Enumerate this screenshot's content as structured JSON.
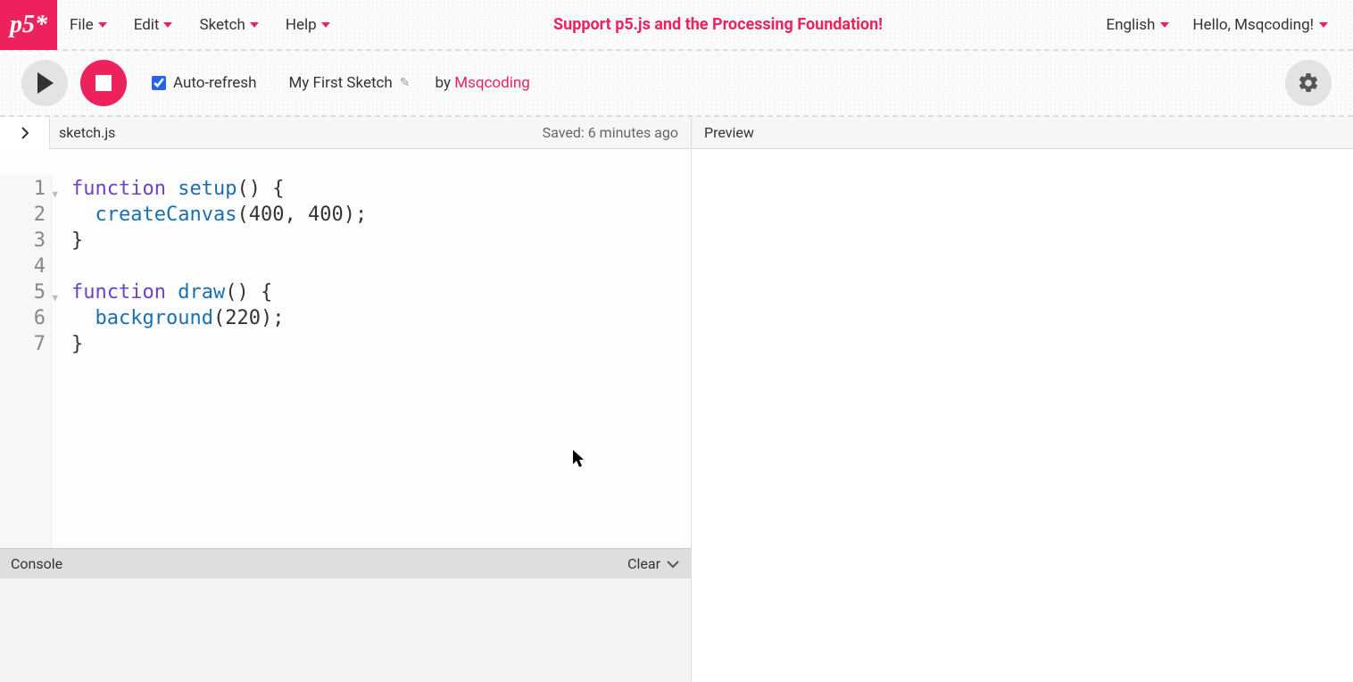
{
  "logo_text": "p5*",
  "menus": {
    "file": "File",
    "edit": "Edit",
    "sketch": "Sketch",
    "help": "Help"
  },
  "support_text": "Support p5.js and the Processing Foundation!",
  "language": "English",
  "greeting": "Hello, Msqcoding!",
  "toolbar": {
    "autorefresh_label": "Auto-refresh",
    "autorefresh_checked": true,
    "sketch_name": "My First Sketch",
    "by_label": "by",
    "author": "Msqcoding"
  },
  "filebar": {
    "filename": "sketch.js",
    "saved_text": "Saved: 6 minutes ago"
  },
  "preview_label": "Preview",
  "code": {
    "lines": [
      {
        "n": 1,
        "fold": true,
        "tokens": [
          [
            "kw",
            "function"
          ],
          [
            "txt",
            " "
          ],
          [
            "fn",
            "setup"
          ],
          [
            "txt",
            "() {"
          ]
        ]
      },
      {
        "n": 2,
        "fold": false,
        "tokens": [
          [
            "txt",
            "  "
          ],
          [
            "fn",
            "createCanvas"
          ],
          [
            "txt",
            "("
          ],
          [
            "num",
            "400"
          ],
          [
            "txt",
            ", "
          ],
          [
            "num",
            "400"
          ],
          [
            "txt",
            ");"
          ]
        ]
      },
      {
        "n": 3,
        "fold": false,
        "tokens": [
          [
            "txt",
            "}"
          ]
        ]
      },
      {
        "n": 4,
        "fold": false,
        "tokens": [
          [
            "txt",
            ""
          ]
        ]
      },
      {
        "n": 5,
        "fold": true,
        "tokens": [
          [
            "kw",
            "function"
          ],
          [
            "txt",
            " "
          ],
          [
            "fn",
            "draw"
          ],
          [
            "txt",
            "() {"
          ]
        ]
      },
      {
        "n": 6,
        "fold": false,
        "tokens": [
          [
            "txt",
            "  "
          ],
          [
            "fn",
            "background"
          ],
          [
            "txt",
            "("
          ],
          [
            "num",
            "220"
          ],
          [
            "txt",
            ");"
          ]
        ]
      },
      {
        "n": 7,
        "fold": false,
        "tokens": [
          [
            "txt",
            "}"
          ]
        ]
      }
    ]
  },
  "console": {
    "label": "Console",
    "clear_label": "Clear"
  }
}
